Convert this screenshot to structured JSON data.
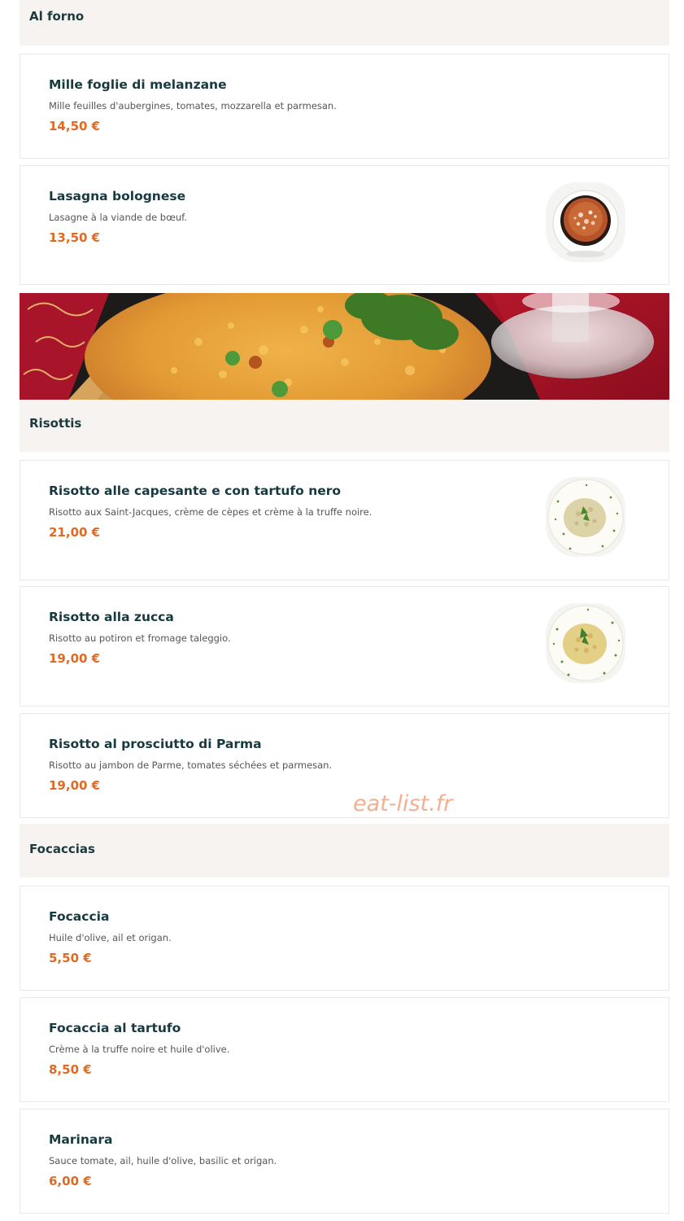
{
  "sections": [
    {
      "title": "Al forno",
      "items": [
        {
          "name": "Mille foglie di melanzane",
          "description": "Mille feuilles d'aubergines, tomates, mozzarella et parmesan.",
          "price": "14,50 €"
        },
        {
          "name": "Lasagna bolognese",
          "description": "Lasagne à la viande de bœuf.",
          "price": "13,50 €",
          "image": "lasagna-dish-photo"
        }
      ]
    },
    {
      "title": "Risottis",
      "banner": "rice-dish-banner-photo",
      "items": [
        {
          "name": "Risotto alle capesante e con tartufo nero",
          "description": "Risotto aux Saint-Jacques, crème de cèpes et crème à la truffe noire.",
          "price": "21,00 €",
          "image": "risotto-plate-photo"
        },
        {
          "name": "Risotto alla zucca",
          "description": "Risotto au potiron et fromage taleggio.",
          "price": "19,00 €",
          "image": "risotto-plate-photo"
        },
        {
          "name": "Risotto al prosciutto di Parma",
          "description": "Risotto au jambon de Parme, tomates séchées et parmesan.",
          "price": "19,00 €"
        }
      ]
    },
    {
      "title": "Focaccias",
      "items": [
        {
          "name": "Focaccia",
          "description": "Huile d'olive, ail et origan.",
          "price": "5,50 €"
        },
        {
          "name": "Focaccia al tartufo",
          "description": "Crème à la truffe noire et huile d'olive.",
          "price": "8,50 €"
        },
        {
          "name": "Marinara",
          "description": "Sauce tomate, ail, huile d'olive, basilic et origan.",
          "price": "6,00 €"
        }
      ]
    }
  ],
  "watermark": "eat-list.fr",
  "colors": {
    "section_bg": "#f6f3f0",
    "title": "#173a40",
    "price": "#e06a24",
    "watermark": "#f0a37d"
  }
}
